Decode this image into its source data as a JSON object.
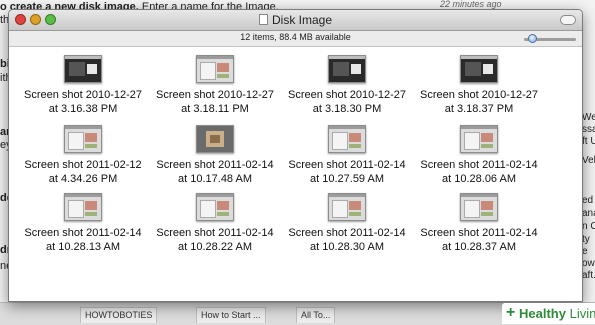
{
  "background": {
    "top_left_bold": "o create a new disk image.",
    "top_left_rest": " Enter a name for the Image,",
    "line2": "the",
    "top_right_time": "22 minutes ago",
    "left_fragments": [
      "bit",
      "ith",
      "and",
      "eyo",
      "der",
      "dra",
      "ne",
      "act"
    ],
    "right_fragments": [
      "Web",
      "ssa",
      "ft U",
      "Veb",
      "ed",
      "ana",
      "n CV",
      "ty",
      "e",
      "own.",
      "aft."
    ],
    "bottom_tabs": [
      "HOWTOBOTIES",
      "How to Start ...",
      "All To..."
    ]
  },
  "window": {
    "title": "Disk Image",
    "status": "12 items, 88.4 MB available",
    "icon_size_slider": 0.15,
    "colors": {
      "close": "#e0443e",
      "minimize": "#dea123",
      "zoom": "#5bbd45"
    }
  },
  "items": [
    {
      "line1": "Screen shot 2010-12-27",
      "line2": "at 3.16.38 PM",
      "thumb": "dark"
    },
    {
      "line1": "Screen shot 2010-12-27",
      "line2": "at 3.18.11 PM",
      "thumb": "light"
    },
    {
      "line1": "Screen shot 2010-12-27",
      "line2": "at 3.18.30 PM",
      "thumb": "dark"
    },
    {
      "line1": "Screen shot 2010-12-27",
      "line2": "at 3.18.37 PM",
      "thumb": "dark"
    },
    {
      "line1": "Screen shot 2011-02-12",
      "line2": "at 4.34.26 PM",
      "thumb": "light"
    },
    {
      "line1": "Screen shot 2011-02-14",
      "line2": "at 10.17.48 AM",
      "thumb": "photo"
    },
    {
      "line1": "Screen shot 2011-02-14",
      "line2": "at 10.27.59 AM",
      "thumb": "light"
    },
    {
      "line1": "Screen shot 2011-02-14",
      "line2": "at 10.28.06 AM",
      "thumb": "light"
    },
    {
      "line1": "Screen shot 2011-02-14",
      "line2": "at 10.28.13 AM",
      "thumb": "light"
    },
    {
      "line1": "Screen shot 2011-02-14",
      "line2": "at 10.28.22 AM",
      "thumb": "light"
    },
    {
      "line1": "Screen shot 2011-02-14",
      "line2": "at 10.28.30 AM",
      "thumb": "light"
    },
    {
      "line1": "Screen shot 2011-02-14",
      "line2": "at 10.28.37 AM",
      "thumb": "light"
    }
  ],
  "watermark": {
    "prefix": "+",
    "brand_bold": "Healthy",
    "brand_rest": "Living"
  }
}
